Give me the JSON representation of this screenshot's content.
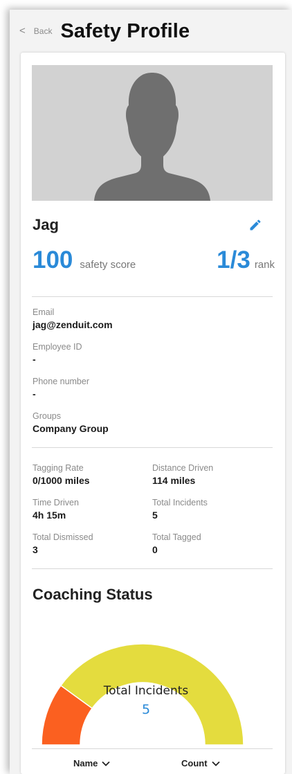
{
  "header": {
    "back_label": "Back",
    "back_glyph": "<",
    "title": "Safety Profile"
  },
  "profile": {
    "photo_icon": "person-silhouette-icon",
    "name": "Jag",
    "edit_icon": "pencil-icon",
    "safety_score": "100",
    "safety_score_label": "safety score",
    "rank": "1/3",
    "rank_label": "rank"
  },
  "details": [
    {
      "label": "Email",
      "value": "jag@zenduit.com"
    },
    {
      "label": "Employee ID",
      "value": "-"
    },
    {
      "label": "Phone number",
      "value": "-"
    },
    {
      "label": "Groups",
      "value": "Company Group"
    }
  ],
  "stats": [
    {
      "label": "Tagging Rate",
      "value": "0/1000 miles"
    },
    {
      "label": "Distance Driven",
      "value": "114 miles"
    },
    {
      "label": "Time Driven",
      "value": "4h 15m"
    },
    {
      "label": "Total Incidents",
      "value": "5"
    },
    {
      "label": "Total Dismissed",
      "value": "3"
    },
    {
      "label": "Total Tagged",
      "value": "0"
    }
  ],
  "coaching": {
    "title": "Coaching Status",
    "gauge_label": "Total Incidents",
    "gauge_value": "5",
    "chart_data": {
      "type": "pie",
      "variant": "half-donut",
      "segments": [
        {
          "value": 1,
          "color": "#fb6020"
        },
        {
          "value": 4,
          "color": "#e4dc3e"
        }
      ],
      "total": 5
    }
  },
  "table": {
    "columns": [
      {
        "label": "Name"
      },
      {
        "label": "Count"
      }
    ]
  },
  "colors": {
    "accent": "#2a8ad8",
    "orange": "#fb6020",
    "yellow": "#e4dc3e"
  }
}
